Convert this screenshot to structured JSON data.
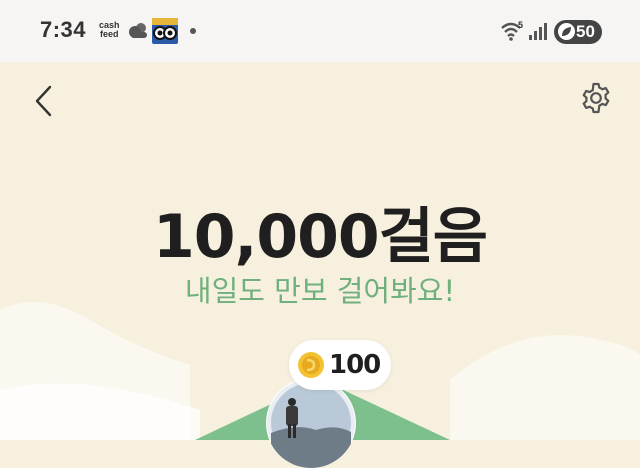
{
  "status_bar": {
    "time": "7:34",
    "cashfeed_line1": "cash",
    "cashfeed_line2": "feed",
    "wifi_badge": "5",
    "battery": "50"
  },
  "header": {
    "back_icon": "chevron-left-icon",
    "settings_icon": "gear-icon"
  },
  "main": {
    "steps_title": "10,000걸음",
    "subtitle": "내일도 만보 걸어봐요!"
  },
  "reward": {
    "coin_amount": "100"
  },
  "colors": {
    "background": "#F7F0DE",
    "accent_green": "#6FB07C",
    "hill_green": "#7DC08E",
    "coin_gold": "#F2C230"
  }
}
